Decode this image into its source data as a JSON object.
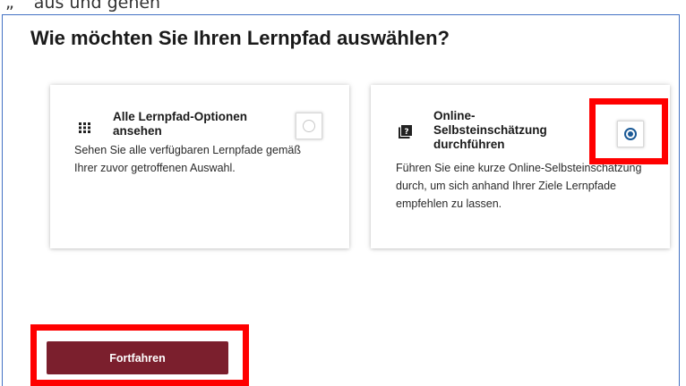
{
  "snippet": "„ “ aus und gehen",
  "page_title": "Wie möchten Sie Ihren Lernpfad auswählen?",
  "options": [
    {
      "title": "Alle Lernpfad-Optionen ansehen",
      "description": "Sehen Sie alle verfügbaren Lernpfade gemäß Ihrer zuvor getroffenen Auswahl.",
      "icon": "grid-icon",
      "selected": false
    },
    {
      "title": "Online-Selbsteinschätzung durchführen",
      "description": "Führen Sie eine kurze Online-Selbsteinschätzung durch, um sich anhand Ihrer Ziele Lernpfade empfehlen zu lassen.",
      "icon": "question-book-icon",
      "selected": true
    }
  ],
  "continue_label": "Fortfahren",
  "colors": {
    "button": "#7b1f2d",
    "radio_checked": "#1b5a96",
    "highlight": "#ff0000",
    "frame": "#4472c4"
  }
}
